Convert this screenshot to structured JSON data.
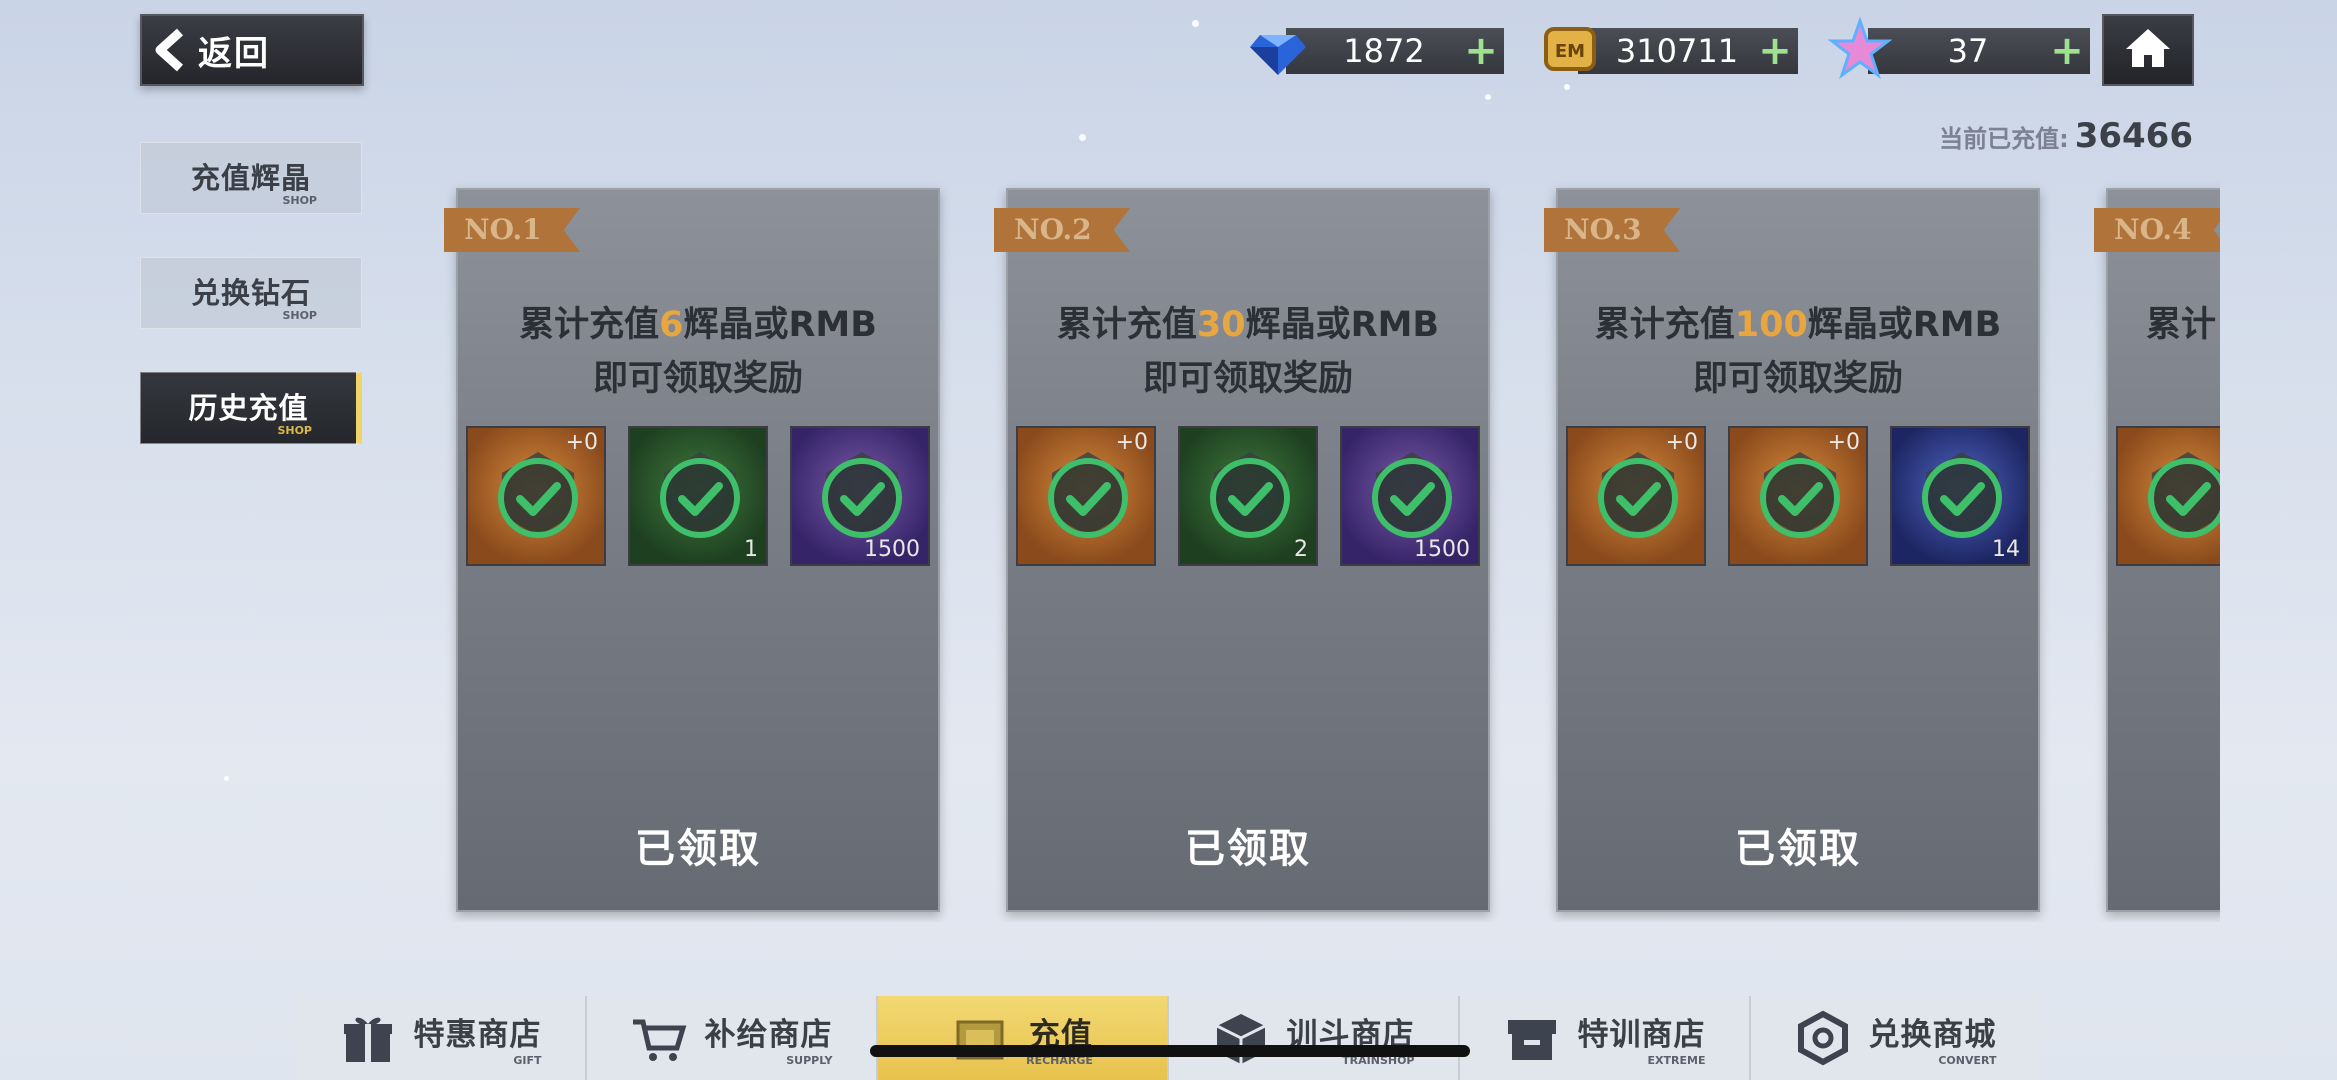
{
  "nav": {
    "back_label": "返回"
  },
  "currencies": [
    {
      "icon": "diamond-icon",
      "value": "1872"
    },
    {
      "icon": "em-coin-icon",
      "value": "310711"
    },
    {
      "icon": "star-icon",
      "value": "37"
    }
  ],
  "recharged": {
    "label": "当前已充值:",
    "value": "36466"
  },
  "sidebar": {
    "items": [
      {
        "label": "充值辉晶",
        "sub": "SHOP"
      },
      {
        "label": "兑换钻石",
        "sub": "SHOP"
      },
      {
        "label": "历史充值",
        "sub": "SHOP"
      }
    ]
  },
  "cards": [
    {
      "rank": "NO.1",
      "title_pre": "累计充值",
      "title_amount": "6",
      "title_post": "辉晶或RMB",
      "line2": "即可领取奖励",
      "items": [
        {
          "tag": "+0",
          "count": ""
        },
        {
          "tag": "",
          "count": "1"
        },
        {
          "tag": "",
          "count": "1500"
        }
      ],
      "status": "已领取"
    },
    {
      "rank": "NO.2",
      "title_pre": "累计充值",
      "title_amount": "30",
      "title_post": "辉晶或RMB",
      "line2": "即可领取奖励",
      "items": [
        {
          "tag": "+0",
          "count": ""
        },
        {
          "tag": "",
          "count": "2"
        },
        {
          "tag": "",
          "count": "1500"
        }
      ],
      "status": "已领取"
    },
    {
      "rank": "NO.3",
      "title_pre": "累计充值",
      "title_amount": "100",
      "title_post": "辉晶或RMB",
      "line2": "即可领取奖励",
      "items": [
        {
          "tag": "+0",
          "count": ""
        },
        {
          "tag": "+0",
          "count": ""
        },
        {
          "tag": "",
          "count": "14"
        }
      ],
      "status": "已领取"
    },
    {
      "rank": "NO.4",
      "title_pre": "累",
      "title_amount": "",
      "title_post": "计",
      "line2": "",
      "items": [
        {
          "tag": "",
          "count": ""
        }
      ],
      "status": ""
    }
  ],
  "tabs": [
    {
      "label": "特惠商店",
      "sub": "GIFT"
    },
    {
      "label": "补给商店",
      "sub": "SUPPLY"
    },
    {
      "label": "充值",
      "sub": "RECHARGE"
    },
    {
      "label": "训斗商店",
      "sub": "TRAINSHOP"
    },
    {
      "label": "特训商店",
      "sub": "EXTREME"
    },
    {
      "label": "兑换商城",
      "sub": "CONVERT"
    }
  ],
  "colors": {
    "accent": "#e8a640",
    "active_tab": "#e7c24d",
    "check": "#3fbf6a"
  }
}
